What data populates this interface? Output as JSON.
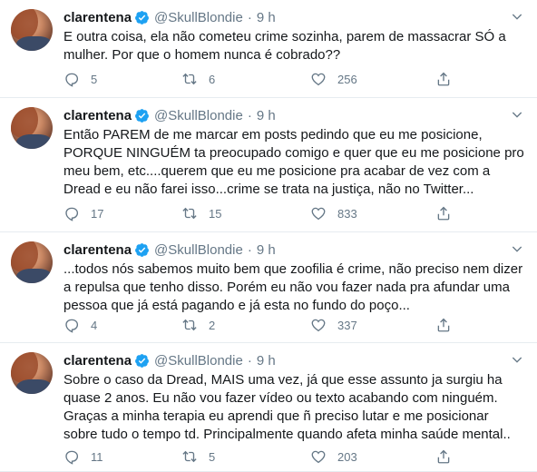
{
  "colors": {
    "accent": "#1da1f2",
    "muted": "#657786",
    "text": "#14171a",
    "divider": "#e6ecf0"
  },
  "tweets": [
    {
      "name": "clarentena",
      "handle": "@SkullBlondie",
      "dot": "·",
      "time": "9 h",
      "text": "E outra coisa, ela não cometeu crime sozinha, parem de massacrar SÓ a mulher. Por que o homem nunca é cobrado??",
      "replies": "5",
      "retweets": "6",
      "likes": "256"
    },
    {
      "name": "clarentena",
      "handle": "@SkullBlondie",
      "dot": "·",
      "time": "9 h",
      "text": "Então PAREM de me marcar em posts pedindo que eu me posicione, PORQUE NINGUÉM ta preocupado comigo e quer que eu me posicione pro meu bem, etc....querem que eu me posicione pra acabar de vez com a Dread e eu não farei isso...crime se trata na justiça, não no Twitter...",
      "replies": "17",
      "retweets": "15",
      "likes": "833"
    },
    {
      "name": "clarentena",
      "handle": "@SkullBlondie",
      "dot": "·",
      "time": "9 h",
      "text": "...todos nós sabemos muito bem que zoofilia é crime, não preciso nem dizer a repulsa que tenho disso. Porém eu não vou fazer nada pra afundar uma pessoa que já está pagando e já esta no fundo do poço...",
      "replies": "4",
      "retweets": "2",
      "likes": "337"
    },
    {
      "name": "clarentena",
      "handle": "@SkullBlondie",
      "dot": "·",
      "time": "9 h",
      "text": "Sobre o caso da Dread, MAIS uma vez, já que esse assunto ja surgiu ha quase 2 anos. Eu não vou fazer vídeo ou texto acabando com ninguém. Graças a minha terapia eu aprendi que ñ preciso lutar e me posicionar sobre tudo o tempo td. Principalmente quando afeta minha saúde mental..",
      "replies": "11",
      "retweets": "5",
      "likes": "203"
    }
  ]
}
